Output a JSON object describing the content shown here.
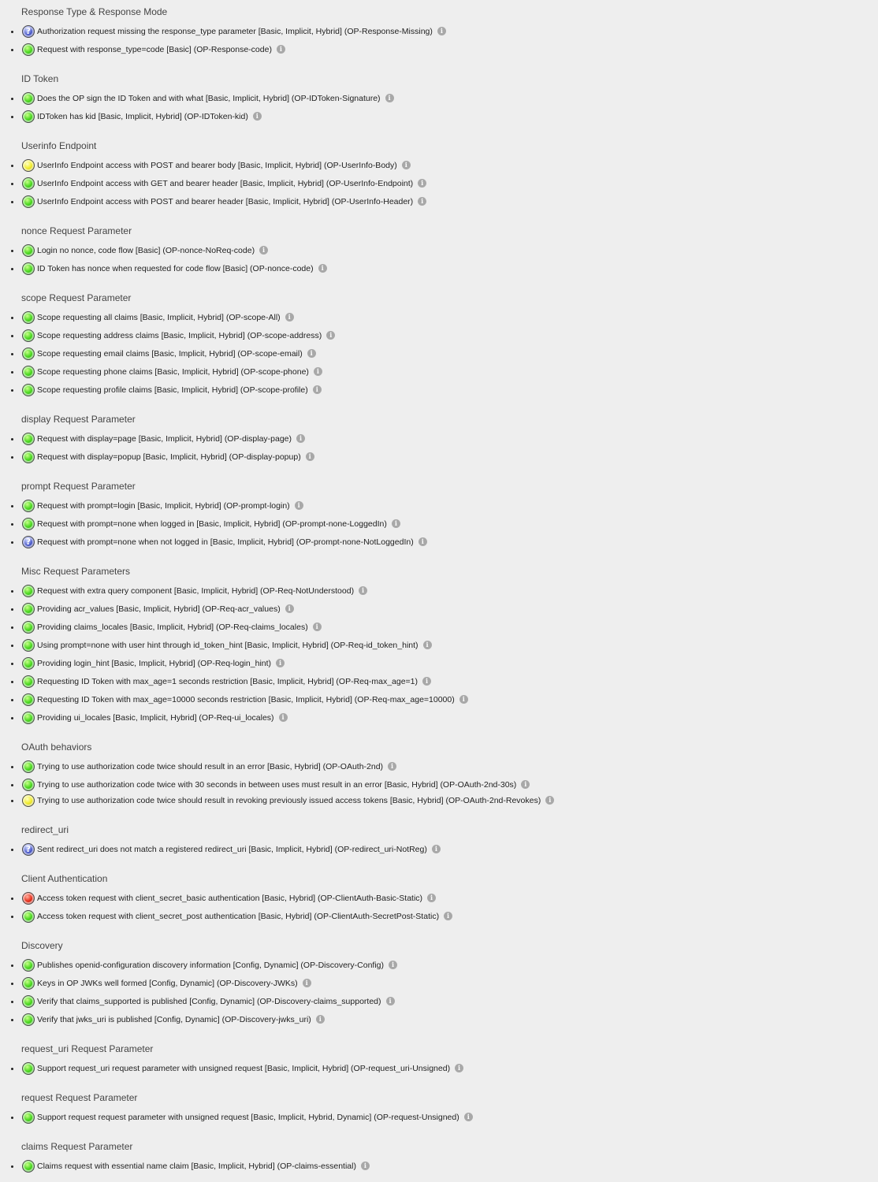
{
  "sections": [
    {
      "title": "Response Type & Response Mode",
      "items": [
        {
          "status": "question",
          "text": "Authorization request missing the response_type parameter [Basic, Implicit, Hybrid] (OP-Response-Missing)"
        },
        {
          "status": "ok",
          "text": "Request with response_type=code [Basic] (OP-Response-code)"
        }
      ]
    },
    {
      "title": "ID Token",
      "items": [
        {
          "status": "ok",
          "text": "Does the OP sign the ID Token and with what [Basic, Implicit, Hybrid] (OP-IDToken-Signature)"
        },
        {
          "status": "ok",
          "text": "IDToken has kid [Basic, Implicit, Hybrid] (OP-IDToken-kid)"
        }
      ]
    },
    {
      "title": "Userinfo Endpoint",
      "items": [
        {
          "status": "warning",
          "text": "UserInfo Endpoint access with POST and bearer body [Basic, Implicit, Hybrid] (OP-UserInfo-Body)"
        },
        {
          "status": "ok",
          "text": "UserInfo Endpoint access with GET and bearer header [Basic, Implicit, Hybrid] (OP-UserInfo-Endpoint)"
        },
        {
          "status": "ok",
          "text": "UserInfo Endpoint access with POST and bearer header [Basic, Implicit, Hybrid] (OP-UserInfo-Header)"
        }
      ]
    },
    {
      "title": "nonce Request Parameter",
      "items": [
        {
          "status": "ok",
          "text": "Login no nonce, code flow [Basic] (OP-nonce-NoReq-code)"
        },
        {
          "status": "ok",
          "text": "ID Token has nonce when requested for code flow [Basic] (OP-nonce-code)"
        }
      ]
    },
    {
      "title": "scope Request Parameter",
      "items": [
        {
          "status": "ok",
          "text": "Scope requesting all claims [Basic, Implicit, Hybrid] (OP-scope-All)"
        },
        {
          "status": "ok",
          "text": "Scope requesting address claims [Basic, Implicit, Hybrid] (OP-scope-address)"
        },
        {
          "status": "ok",
          "text": "Scope requesting email claims [Basic, Implicit, Hybrid] (OP-scope-email)"
        },
        {
          "status": "ok",
          "text": "Scope requesting phone claims [Basic, Implicit, Hybrid] (OP-scope-phone)"
        },
        {
          "status": "ok",
          "text": "Scope requesting profile claims [Basic, Implicit, Hybrid] (OP-scope-profile)"
        }
      ]
    },
    {
      "title": "display Request Parameter",
      "items": [
        {
          "status": "ok",
          "text": "Request with display=page [Basic, Implicit, Hybrid] (OP-display-page)"
        },
        {
          "status": "ok",
          "text": "Request with display=popup [Basic, Implicit, Hybrid] (OP-display-popup)"
        }
      ]
    },
    {
      "title": "prompt Request Parameter",
      "items": [
        {
          "status": "ok",
          "text": "Request with prompt=login [Basic, Implicit, Hybrid] (OP-prompt-login)"
        },
        {
          "status": "ok",
          "text": "Request with prompt=none when logged in [Basic, Implicit, Hybrid] (OP-prompt-none-LoggedIn)"
        },
        {
          "status": "question",
          "text": "Request with prompt=none when not logged in [Basic, Implicit, Hybrid] (OP-prompt-none-NotLoggedIn)"
        }
      ]
    },
    {
      "title": "Misc Request Parameters",
      "items": [
        {
          "status": "ok",
          "text": "Request with extra query component [Basic, Implicit, Hybrid] (OP-Req-NotUnderstood)"
        },
        {
          "status": "ok",
          "text": "Providing acr_values [Basic, Implicit, Hybrid] (OP-Req-acr_values)"
        },
        {
          "status": "ok",
          "text": "Providing claims_locales [Basic, Implicit, Hybrid] (OP-Req-claims_locales)"
        },
        {
          "status": "ok",
          "text": "Using prompt=none with user hint through id_token_hint [Basic, Implicit, Hybrid] (OP-Req-id_token_hint)"
        },
        {
          "status": "ok",
          "text": "Providing login_hint [Basic, Implicit, Hybrid] (OP-Req-login_hint)"
        },
        {
          "status": "ok",
          "text": "Requesting ID Token with max_age=1 seconds restriction [Basic, Implicit, Hybrid] (OP-Req-max_age=1)"
        },
        {
          "status": "ok",
          "text": "Requesting ID Token with max_age=10000 seconds restriction [Basic, Implicit, Hybrid] (OP-Req-max_age=10000)"
        },
        {
          "status": "ok",
          "text": "Providing ui_locales [Basic, Implicit, Hybrid] (OP-Req-ui_locales)"
        }
      ]
    },
    {
      "title": "OAuth behaviors",
      "items": [
        {
          "status": "ok",
          "text": "Trying to use authorization code twice should result in an error [Basic, Hybrid] (OP-OAuth-2nd)"
        },
        {
          "status": "ok",
          "text": "Trying to use authorization code twice with 30 seconds in between uses must result in an error [Basic, Hybrid] (OP-OAuth-2nd-30s)"
        },
        {
          "status": "warning",
          "text": "Trying to use authorization code twice should result in revoking previously issued access tokens [Basic, Hybrid] (OP-OAuth-2nd-Revokes)"
        }
      ]
    },
    {
      "title": "redirect_uri",
      "items": [
        {
          "status": "question",
          "text": "Sent redirect_uri does not match a registered redirect_uri [Basic, Implicit, Hybrid] (OP-redirect_uri-NotReg)"
        }
      ]
    },
    {
      "title": "Client Authentication",
      "items": [
        {
          "status": "error",
          "text": "Access token request with client_secret_basic authentication [Basic, Hybrid] (OP-ClientAuth-Basic-Static)"
        },
        {
          "status": "ok",
          "text": "Access token request with client_secret_post authentication [Basic, Hybrid] (OP-ClientAuth-SecretPost-Static)"
        }
      ]
    },
    {
      "title": "Discovery",
      "items": [
        {
          "status": "ok",
          "text": "Publishes openid-configuration discovery information [Config, Dynamic] (OP-Discovery-Config)"
        },
        {
          "status": "ok",
          "text": "Keys in OP JWKs well formed [Config, Dynamic] (OP-Discovery-JWKs)"
        },
        {
          "status": "ok",
          "text": "Verify that claims_supported is published [Config, Dynamic] (OP-Discovery-claims_supported)"
        },
        {
          "status": "ok",
          "text": "Verify that jwks_uri is published [Config, Dynamic] (OP-Discovery-jwks_uri)"
        }
      ]
    },
    {
      "title": "request_uri Request Parameter",
      "items": [
        {
          "status": "ok",
          "text": "Support request_uri request parameter with unsigned request [Basic, Implicit, Hybrid] (OP-request_uri-Unsigned)"
        }
      ]
    },
    {
      "title": "request Request Parameter",
      "items": [
        {
          "status": "ok",
          "text": "Support request request parameter with unsigned request [Basic, Implicit, Hybrid, Dynamic] (OP-request-Unsigned)"
        }
      ]
    },
    {
      "title": "claims Request Parameter",
      "items": [
        {
          "status": "ok",
          "text": "Claims request with essential name claim [Basic, Implicit, Hybrid] (OP-claims-essential)"
        }
      ]
    }
  ]
}
